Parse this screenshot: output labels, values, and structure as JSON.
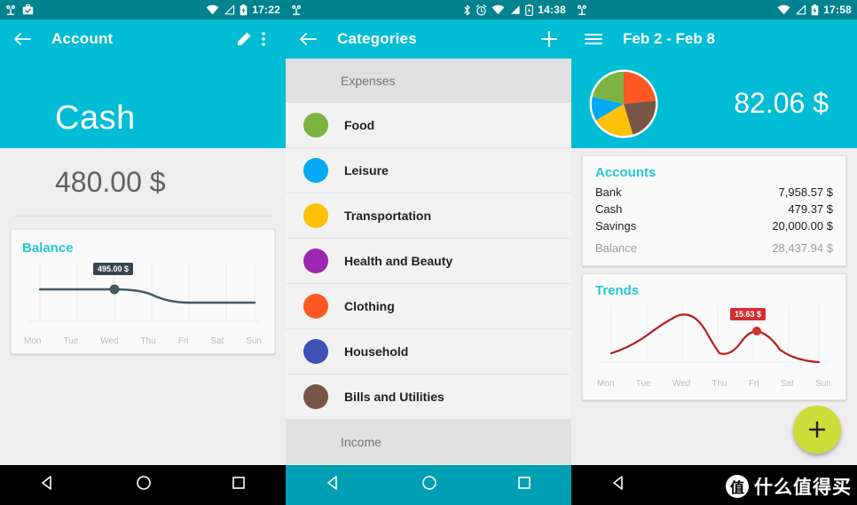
{
  "theme": {
    "status_bar": "#00838f",
    "app_bar": "#00bcd4",
    "accent": "#26c6da",
    "background": "#eeeeee",
    "fab": "#cddc39"
  },
  "screen1": {
    "status": {
      "time": "17:22",
      "icons": [
        "owl-app-icon",
        "briefcase-check-icon",
        "wifi-icon",
        "signal-icon",
        "battery-charging-icon"
      ]
    },
    "appbar": {
      "title": "Account",
      "back": "back-arrow-icon",
      "edit": "pencil-icon",
      "overflow": "more-vert-icon"
    },
    "account_name": "Cash",
    "account_amount": "480.00 $",
    "card": {
      "title": "Balance",
      "tooltip": "495.00 $"
    },
    "nav": {
      "back": "triangle-back-icon",
      "home": "circle-home-icon",
      "recents": "square-recents-icon"
    },
    "chart_data": {
      "type": "line",
      "title": "Balance",
      "x": [
        "Mon",
        "Tue",
        "Wed",
        "Thu",
        "Fri",
        "Sat",
        "Sun"
      ],
      "values": [
        495.0,
        495.0,
        495.0,
        495.0,
        480.0,
        480.0,
        480.0
      ],
      "highlight": {
        "x": "Wed",
        "value": 495.0,
        "label": "495.00 $"
      },
      "ylim": [
        470,
        505
      ],
      "grid": true,
      "xlabel": "",
      "ylabel": "",
      "series_color": "#455a64",
      "legend": "none"
    }
  },
  "screen2": {
    "status": {
      "time": "14:38",
      "icons": [
        "owl-app-icon",
        "bluetooth-icon",
        "alarm-icon",
        "wifi-icon",
        "signal-icon",
        "battery-charging-icon"
      ]
    },
    "appbar": {
      "title": "Categories",
      "back": "back-arrow-icon",
      "add": "plus-icon"
    },
    "sections": [
      {
        "header": "Expenses",
        "items": [
          {
            "label": "Food",
            "color": "#7cb342"
          },
          {
            "label": "Leisure",
            "color": "#03a9f4"
          },
          {
            "label": "Transportation",
            "color": "#ffc107"
          },
          {
            "label": "Health and Beauty",
            "color": "#9c27b0"
          },
          {
            "label": "Clothing",
            "color": "#ff5722"
          },
          {
            "label": "Household",
            "color": "#3f51b5"
          },
          {
            "label": "Bills and Utilities",
            "color": "#795548"
          }
        ]
      },
      {
        "header": "Income",
        "items": []
      }
    ],
    "nav": {
      "back": "triangle-back-icon",
      "home": "circle-home-icon",
      "recents": "square-recents-icon"
    }
  },
  "screen3": {
    "status": {
      "time": "17:58",
      "icons": [
        "owl-app-icon",
        "wifi-icon",
        "signal-icon",
        "battery-charging-icon"
      ]
    },
    "appbar": {
      "title": "Feb 2 - Feb 8",
      "menu": "hamburger-menu-icon"
    },
    "total": "82.06 $",
    "accounts_card": {
      "title": "Accounts",
      "rows": [
        {
          "name": "Bank",
          "value": "7,958.57 $"
        },
        {
          "name": "Cash",
          "value": "479.37 $"
        },
        {
          "name": "Savings",
          "value": "20,000.00 $"
        }
      ],
      "balance": {
        "name": "Balance",
        "value": "28,437.94 $"
      }
    },
    "trends_card": {
      "title": "Trends",
      "tooltip": "15.63 $"
    },
    "fab": {
      "icon": "plus-icon",
      "color": "#cddc39"
    },
    "nav": {
      "back": "triangle-back-icon"
    },
    "watermark": {
      "logo": "值",
      "text": "什么值得买"
    },
    "chart_data": [
      {
        "type": "pie",
        "title": "Feb 2 - Feb 8 expenses",
        "total": "82.06 $",
        "labels": [
          "Clothing",
          "Bills and Utilities",
          "Transportation",
          "Leisure",
          "Food"
        ],
        "values": [
          26,
          24,
          21,
          18,
          11
        ],
        "colors": [
          "#ff5722",
          "#795548",
          "#ffc107",
          "#03a9f4",
          "#7cb342"
        ],
        "legend": "none"
      },
      {
        "type": "line",
        "title": "Trends",
        "x": [
          "Mon",
          "Tue",
          "Wed",
          "Thu",
          "Fri",
          "Sat",
          "Sun"
        ],
        "values": [
          4.0,
          11.0,
          22.5,
          3.5,
          15.63,
          2.5,
          1.0
        ],
        "highlight": {
          "x": "Fri",
          "value": 15.63,
          "label": "15.63 $"
        },
        "ylim": [
          0,
          25
        ],
        "grid": true,
        "xlabel": "",
        "ylabel": "",
        "series_color": "#b71c1c",
        "legend": "none"
      }
    ]
  }
}
